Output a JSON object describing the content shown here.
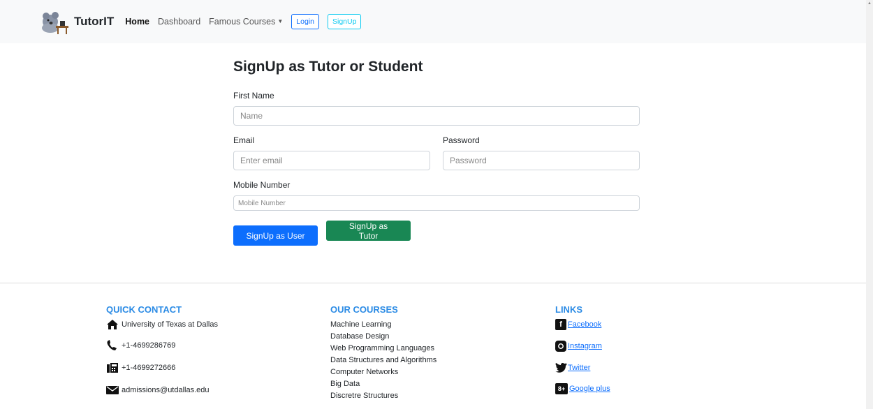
{
  "navbar": {
    "brand": "TutorIT",
    "links": [
      {
        "label": "Home"
      },
      {
        "label": "Dashboard"
      },
      {
        "label": "Famous Courses"
      }
    ],
    "login_label": "Login",
    "signup_label": "SignUp"
  },
  "form": {
    "title": "SignUp as Tutor or Student",
    "first_name": {
      "label": "First Name",
      "placeholder": "Name",
      "value": ""
    },
    "email": {
      "label": "Email",
      "placeholder": "Enter email",
      "value": ""
    },
    "password": {
      "label": "Password",
      "placeholder": "Password",
      "value": ""
    },
    "mobile": {
      "label": "Mobile Number",
      "placeholder": "Mobile Number",
      "value": ""
    },
    "signup_user_label": "SignUp as User",
    "signup_tutor_label": "SignUp as Tutor"
  },
  "footer": {
    "quick_contact": {
      "heading": "QUICK CONTACT",
      "items": [
        {
          "icon": "home-icon",
          "text": "University of Texas at Dallas"
        },
        {
          "icon": "phone-icon",
          "text": "+1-4699286769"
        },
        {
          "icon": "fax-icon",
          "text": "+1-4699272666"
        },
        {
          "icon": "envelope-icon",
          "text": "admissions@utdallas.edu"
        }
      ]
    },
    "courses": {
      "heading": "OUR COURSES",
      "items": [
        "Machine Learning",
        "Database Design",
        "Web Programming Languages",
        "Data Structures and Algorithms",
        "Computer Networks",
        "Big Data",
        "Discretre Structures"
      ]
    },
    "links": {
      "heading": "LINKS",
      "items": [
        {
          "icon": "facebook-icon",
          "label": "Facebook"
        },
        {
          "icon": "instagram-icon",
          "label": "Instagram"
        },
        {
          "icon": "twitter-icon",
          "label": "Twitter"
        },
        {
          "icon": "google-plus-icon",
          "label": "Google plus"
        }
      ]
    }
  },
  "colors": {
    "primary": "#0d6efd",
    "success": "#198754",
    "footer_heading": "#2b8be5",
    "navbar_bg": "#f8f9fa"
  }
}
